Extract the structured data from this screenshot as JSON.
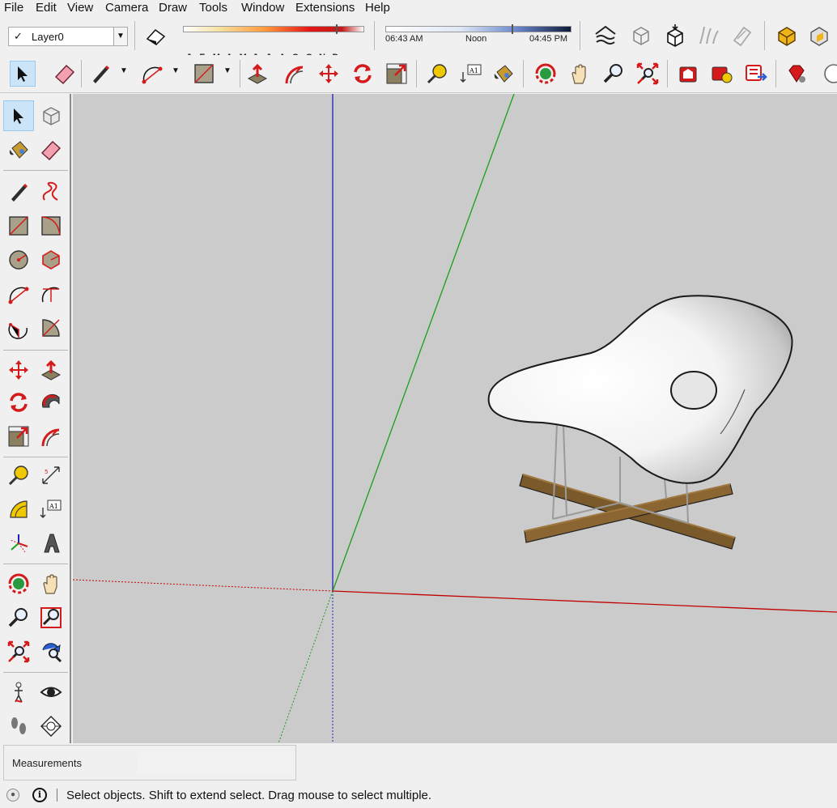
{
  "menu": [
    "File",
    "Edit",
    "View",
    "Camera",
    "Draw",
    "Tools",
    "Window",
    "Extensions",
    "Help"
  ],
  "layers": {
    "current": "Layer0",
    "check": "✓"
  },
  "shadows": {
    "months": [
      "J",
      "F",
      "M",
      "A",
      "M",
      "J",
      "J",
      "A",
      "S",
      "O",
      "N",
      "D"
    ],
    "time_start": "06:43 AM",
    "time_mid": "Noon",
    "time_end": "04:45 PM"
  },
  "measurements": {
    "label": "Measurements",
    "value": ""
  },
  "status": {
    "text": "Select objects. Shift to extend select. Drag mouse to select multiple."
  },
  "colors": {
    "axis_red": "#c00000",
    "axis_green": "#18a018",
    "axis_blue": "#2020c0",
    "viewport_bg": "#cbcbcb",
    "accent_red": "#d41a1a"
  }
}
